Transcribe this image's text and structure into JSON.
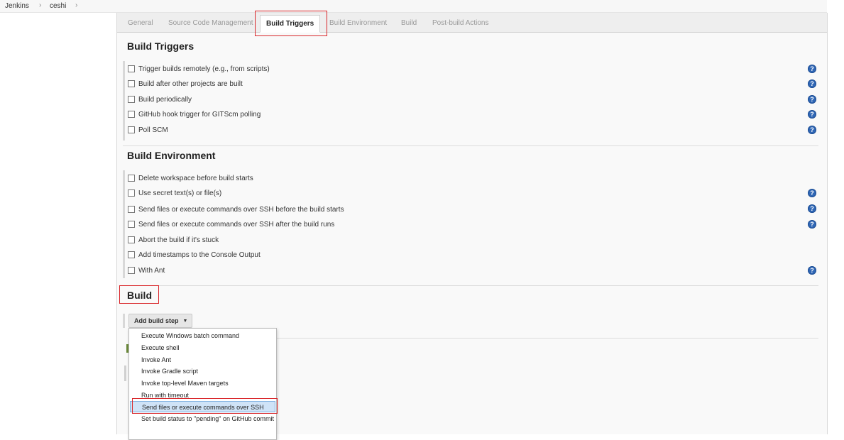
{
  "breadcrumb": {
    "items": [
      "Jenkins",
      "ceshi"
    ],
    "separator": "›"
  },
  "tabs": [
    "General",
    "Source Code Management",
    "Build Triggers",
    "Build Environment",
    "Build",
    "Post-build Actions"
  ],
  "active_tab": "Build Triggers",
  "build_triggers": {
    "title": "Build Triggers",
    "options": [
      "Trigger builds remotely (e.g., from scripts)",
      "Build after other projects are built",
      "Build periodically",
      "GitHub hook trigger for GITScm polling",
      "Poll SCM"
    ]
  },
  "build_environment": {
    "title": "Build Environment",
    "options": [
      "Delete workspace before build starts",
      "Use secret text(s) or file(s)",
      "Send files or execute commands over SSH before the build starts",
      "Send files or execute commands over SSH after the build runs",
      "Abort the build if it's stuck",
      "Add timestamps to the Console Output",
      "With Ant"
    ]
  },
  "build": {
    "title": "Build",
    "add_step_label": "Add build step",
    "menu_items": [
      "Execute Windows batch command",
      "Execute shell",
      "Invoke Ant",
      "Invoke Gradle script",
      "Invoke top-level Maven targets",
      "Run with timeout",
      "Send files or execute commands over SSH",
      "Set build status to \"pending\" on GitHub commit"
    ],
    "selected_item": "Send files or execute commands over SSH"
  },
  "help_icon_glyph": "?",
  "colors": {
    "highlight": "#d9262a",
    "help_icon": "#2f66b5",
    "menu_selected": "#cfe3f7"
  }
}
